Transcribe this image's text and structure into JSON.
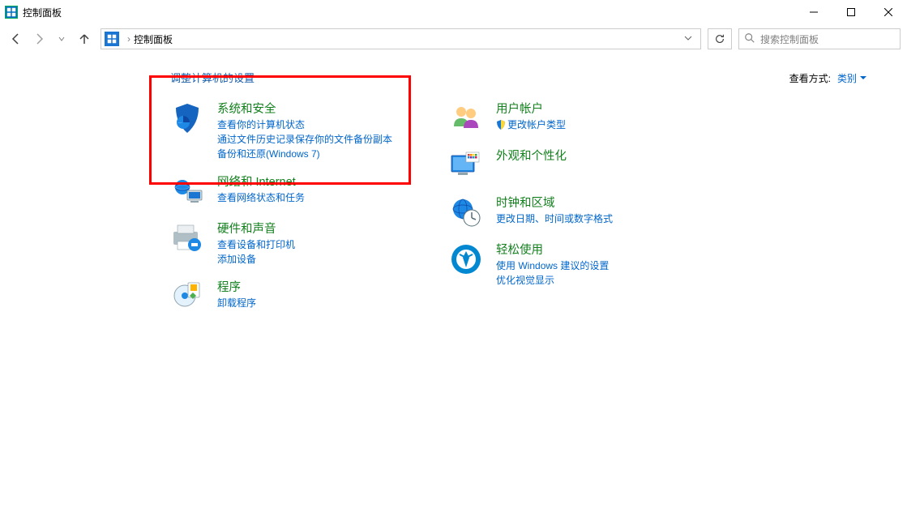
{
  "window": {
    "title": "控制面板",
    "minimize": "—",
    "maximize": "☐",
    "close": "✕"
  },
  "nav": {
    "back": "←",
    "forward": "→",
    "up": "↑",
    "address": "控制面板",
    "refresh": "⟳"
  },
  "search": {
    "placeholder": "搜索控制面板"
  },
  "header": {
    "adjust": "调整计算机的设置",
    "viewLabel": "查看方式:",
    "viewValue": "类别"
  },
  "leftCol": [
    {
      "title": "系统和安全",
      "icon": "shield-icon",
      "links": [
        "查看你的计算机状态",
        "通过文件历史记录保存你的文件备份副本",
        "备份和还原(Windows 7)"
      ]
    },
    {
      "title": "网络和 Internet",
      "icon": "network-icon",
      "links": [
        "查看网络状态和任务"
      ]
    },
    {
      "title": "硬件和声音",
      "icon": "printer-icon",
      "links": [
        "查看设备和打印机",
        "添加设备"
      ]
    },
    {
      "title": "程序",
      "icon": "programs-icon",
      "links": [
        "卸载程序"
      ]
    }
  ],
  "rightCol": [
    {
      "title": "用户帐户",
      "icon": "users-icon",
      "badge": true,
      "links": [
        "更改帐户类型"
      ]
    },
    {
      "title": "外观和个性化",
      "icon": "appearance-icon",
      "links": []
    },
    {
      "title": "时钟和区域",
      "icon": "clock-icon",
      "links": [
        "更改日期、时间或数字格式"
      ]
    },
    {
      "title": "轻松使用",
      "icon": "ease-icon",
      "links": [
        "使用 Windows 建议的设置",
        "优化视觉显示"
      ]
    }
  ]
}
